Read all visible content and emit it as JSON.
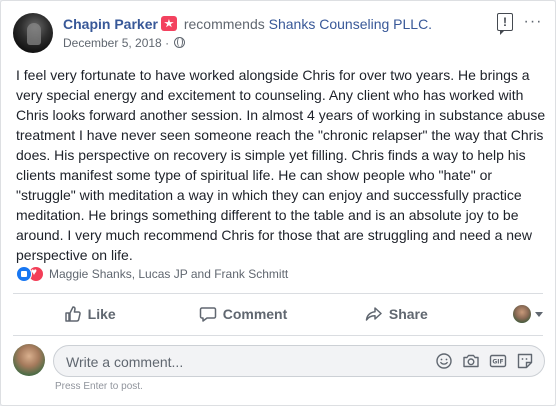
{
  "post": {
    "author": "Chapin Parker",
    "verb": "recommends",
    "page": "Shanks Counseling PLLC.",
    "date": "December 5, 2018",
    "separator": "·",
    "text": "I feel very fortunate to have worked alongside Chris for over two years. He brings a very special energy and excitement to counseling. Any client who has worked with Chris looks forward another session. In almost 4 years of working in substance abuse treatment I have never seen someone reach the \"chronic relapser\" the way that Chris does. His perspective on recovery is simple yet filling. Chris finds a way to help his clients manifest some type of spiritual life. He can show people who \"hate\" or \"struggle\" with meditation a way in which they can enjoy and successfully practice meditation. He brings something different to the table and is an absolute joy to be around. I very much recommend Chris for those that are struggling and need a new perspective on life.",
    "more_label": "···",
    "report_label": "!"
  },
  "reactions": {
    "icons": [
      "like-icon",
      "love-icon"
    ],
    "names": "Maggie Shanks, Lucas JP and Frank Schmitt"
  },
  "actions": {
    "like": "Like",
    "comment": "Comment",
    "share": "Share"
  },
  "composer": {
    "placeholder": "Write a comment...",
    "hint": "Press Enter to post.",
    "icons": [
      "emoji-icon",
      "camera-icon",
      "gif-icon",
      "sticker-icon"
    ]
  },
  "colors": {
    "link": "#385898",
    "muted": "#606770",
    "like_blue": "#1877f2",
    "love_red": "#f33e58",
    "recommend_badge": "#f3425f"
  }
}
